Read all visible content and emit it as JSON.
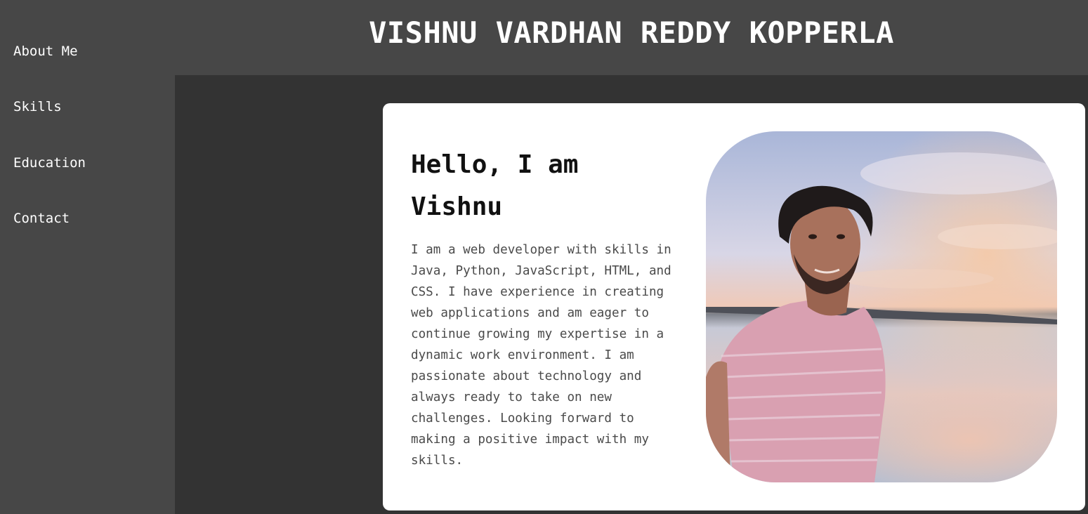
{
  "header": {
    "title": "VISHNU VARDHAN REDDY KOPPERLA"
  },
  "sidebar": {
    "items": [
      {
        "label": "About Me"
      },
      {
        "label": "Skills"
      },
      {
        "label": "Education"
      },
      {
        "label": "Contact"
      }
    ]
  },
  "about": {
    "greeting": "Hello, I am Vishnu",
    "bio": "I am a web developer with skills in Java, Python, JavaScript, HTML, and CSS. I have experience in creating web applications and am eager to continue growing my expertise in a dynamic work environment. I am passionate about technology and always ready to take on new challenges. Looking forward to making a positive impact with my skills.",
    "photo_alt": "profile-photo"
  },
  "colors": {
    "background": "#333333",
    "sidebar": "#474747",
    "header": "#474747",
    "card": "#ffffff",
    "text_light": "#ffffff",
    "text_dark": "#111111",
    "text_body": "#4a4a4a"
  }
}
